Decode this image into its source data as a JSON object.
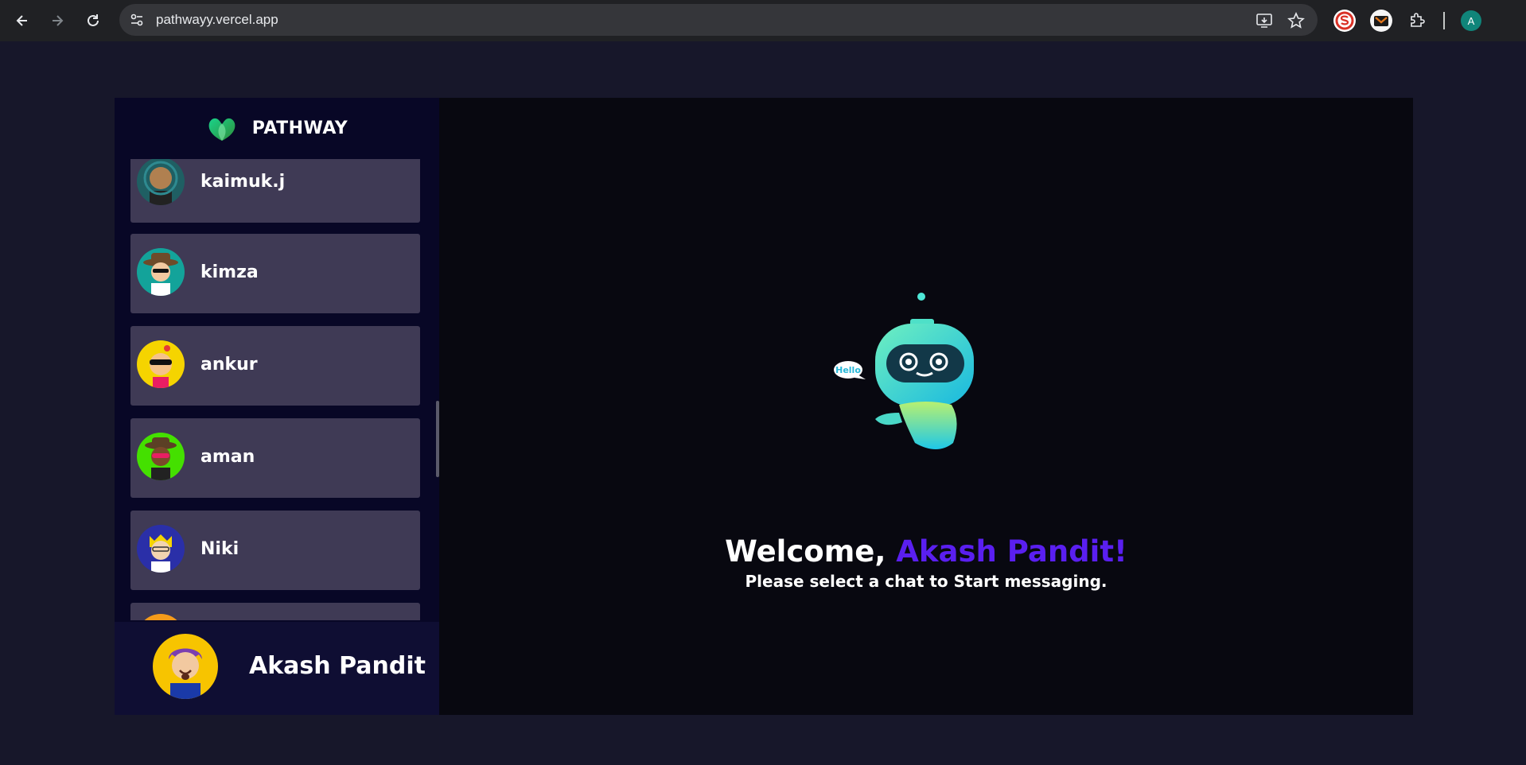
{
  "browser": {
    "url": "pathwayy.vercel.app",
    "profile_initial": "A"
  },
  "app": {
    "brand": "PATHWAY",
    "contacts": [
      {
        "name": "kaimuk.j",
        "avatar_color": "#1f5f63"
      },
      {
        "name": "kimza",
        "avatar_color": "#13a39a"
      },
      {
        "name": "ankur",
        "avatar_color": "#f5d400"
      },
      {
        "name": "aman",
        "avatar_color": "#44e000"
      },
      {
        "name": "Niki",
        "avatar_color": "#2a2fa8"
      }
    ],
    "current_user": {
      "name": "Akash Pandit",
      "avatar_color": "#f7c400"
    },
    "welcome": {
      "prefix": "Welcome, ",
      "name": "Akash Pandit!",
      "subtitle": "Please select a chat to Start messaging.",
      "bubble_text": "Hello"
    }
  }
}
